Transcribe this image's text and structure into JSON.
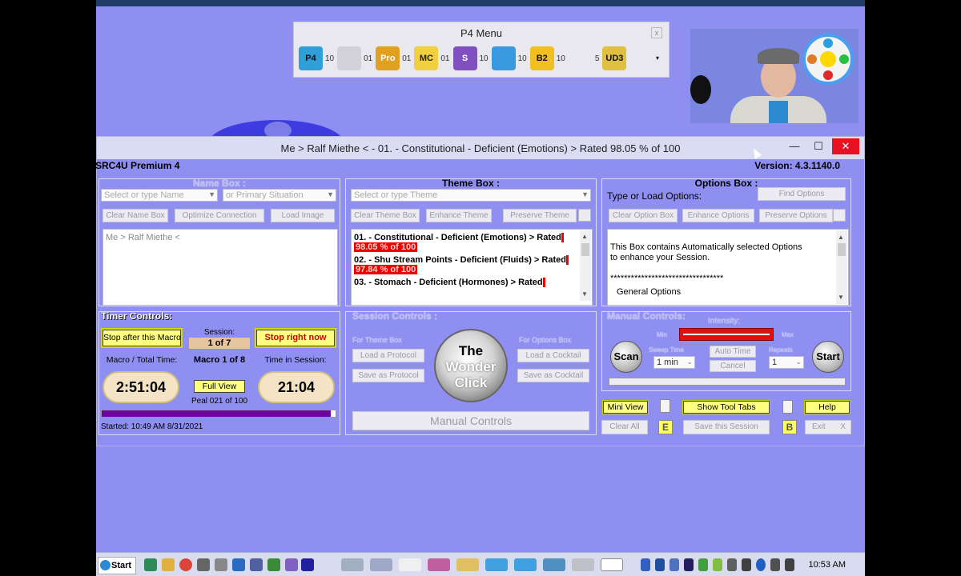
{
  "p4_menu": {
    "title": "P4 Menu",
    "close": "x",
    "items": [
      {
        "icon": "p4-icon",
        "label": "P4",
        "count": "10",
        "bg": "#2e9fd8",
        "fg": "#111"
      },
      {
        "icon": "clock-icon",
        "label": "",
        "count": "01",
        "bg": "#d2d2d8",
        "fg": "#888"
      },
      {
        "icon": "src4u-pro-icon",
        "label": "Pro",
        "count": "01",
        "bg": "#e0a020",
        "fg": "#fff"
      },
      {
        "icon": "mc-master-controller-icon",
        "label": "MC",
        "count": "01",
        "bg": "#f0d040",
        "fg": "#222"
      },
      {
        "icon": "spiral-s-icon",
        "label": "S",
        "count": "10",
        "bg": "#8050c0",
        "fg": "#fff"
      },
      {
        "icon": "runner-icon",
        "label": "",
        "count": "10",
        "bg": "#3a9ae0",
        "fg": "#fff"
      },
      {
        "icon": "b2-icon",
        "label": "B2",
        "count": "10",
        "bg": "#f0c020",
        "fg": "#111"
      },
      {
        "icon": "spiral-icon",
        "label": "",
        "count": "5",
        "bg": "#e8e8ee",
        "fg": "#111"
      },
      {
        "icon": "src4u-ud3-icon",
        "label": "UD3",
        "count": "",
        "bg": "#e0c040",
        "fg": "#111"
      }
    ]
  },
  "window": {
    "title": "Me > Ralf Miethe < - 01. - Constitutional - Deficient (Emotions) > Rated  98.05 % of 100",
    "app_name": "SRC4U Premium 4",
    "version": "Version: 4.3.1140.0",
    "minimize": "—",
    "maximize": "☐",
    "close": "✕"
  },
  "name_box": {
    "title": "Name Box :",
    "name_placeholder": "Select or type Name",
    "situation_placeholder": "or Primary Situation",
    "buttons": [
      "Clear Name Box",
      "Optimize Connection",
      "Load Image"
    ],
    "content": "Me > Ralf Miethe <"
  },
  "theme_box": {
    "title": "Theme Box :",
    "placeholder": "Select or type Theme",
    "buttons": [
      "Clear Theme Box",
      "Enhance Theme",
      "Preserve Theme"
    ],
    "items": [
      {
        "text": "01. - Constitutional - Deficient (Emotions) > Rated",
        "rating": "98.05 % of 100"
      },
      {
        "text": "02. - Shu Stream Points - Deficient (Fluids) > Rated",
        "rating": "97.84 % of 100"
      },
      {
        "text": "03. - Stomach - Deficient (Hormones) > Rated",
        "rating": ""
      }
    ]
  },
  "options_box": {
    "title": "Options Box :",
    "label": "Type or Load Options:",
    "find": "Find Options",
    "buttons": [
      "Clear Option Box",
      "Enhance Options",
      "Preserve Options"
    ],
    "line1": "This Box contains Automatically selected Options",
    "line2": "to enhance your Session.",
    "stars": "*********************************",
    "general": "General Options"
  },
  "timer": {
    "title": "Timer Controls:",
    "stop_after": "Stop after this Macro",
    "session_label": "Session:",
    "session_value": "1 of 7",
    "stop_now": "Stop right now",
    "macro_total_label": "Macro / Total Time:",
    "macro_of": "Macro 1 of 8",
    "time_in_session_label": "Time in Session:",
    "total_time": "2:51:04",
    "full_view": "Full View",
    "session_time": "21:04",
    "peal": "Peal  021 of 100",
    "progress": 0.98,
    "started": "Started: 10:49 AM 8/31/2021"
  },
  "session_controls": {
    "title": "Session Controls :",
    "for_theme": "For Theme Box",
    "for_options": "For Options Box",
    "load_protocol": "Load a Protocol",
    "save_protocol": "Save as Protocol",
    "load_cocktail": "Load a Cocktail",
    "save_cocktail": "Save as Cocktail",
    "wonder_1": "The",
    "wonder_2": "Wonder",
    "wonder_3": "Click",
    "manual_controls": "Manual Controls"
  },
  "manual_controls": {
    "title": "Manual Controls:",
    "intensity": "Intensity:",
    "min": "Min",
    "max": "Max",
    "scan": "Scan",
    "sweep_time": "Sweep Time",
    "sweep_value": "1 min",
    "auto_time": "Auto Time",
    "cancel": "Cancel",
    "repeats": "Repeats",
    "repeats_value": "1",
    "start": "Start"
  },
  "bottom_buttons": {
    "mini_view": "Mini View",
    "show_tool_tabs": "Show Tool Tabs",
    "help": "Help",
    "clear_all": "Clear All",
    "e": "E",
    "save_session": "Save this Session",
    "b": "B",
    "exit": "Exit",
    "x": "X"
  },
  "taskbar": {
    "start": "Start",
    "clock": "10:53 AM"
  }
}
